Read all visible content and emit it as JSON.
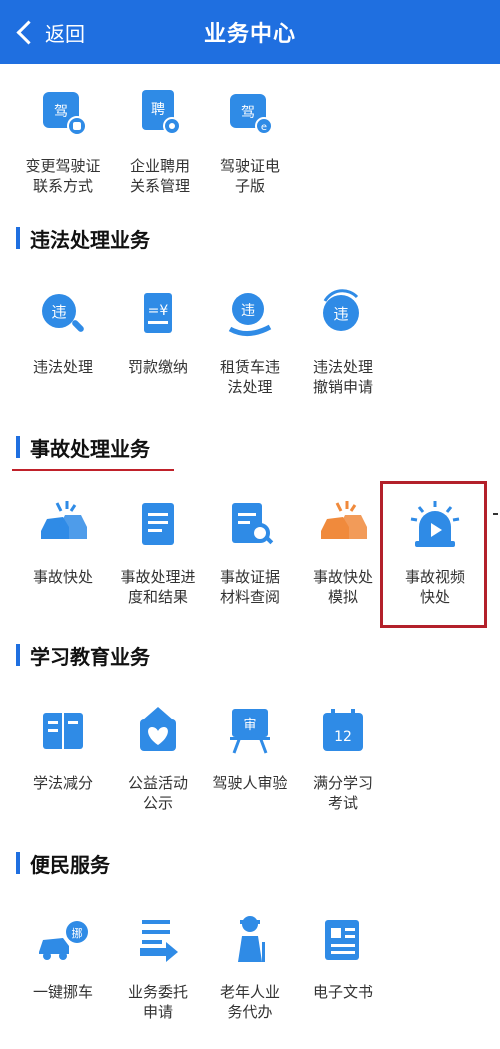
{
  "header": {
    "back_label": "返回",
    "title": "业务中心"
  },
  "top_row": [
    {
      "label": "变更驾驶证\n联系方式",
      "icon": "license-phone-icon"
    },
    {
      "label": "企业聘用\n关系管理",
      "icon": "hire-document-icon"
    },
    {
      "label": "驾驶证电\n子版",
      "icon": "e-license-icon"
    }
  ],
  "sections": [
    {
      "title": "违法处理业务",
      "items": [
        {
          "label": "违法处理",
          "icon": "violation-search-icon"
        },
        {
          "label": "罚款缴纳",
          "icon": "fine-payment-icon"
        },
        {
          "label": "租赁车违\n法处理",
          "icon": "rental-violation-icon"
        },
        {
          "label": "违法处理\n撤销申请",
          "icon": "violation-revoke-icon"
        }
      ]
    },
    {
      "title": "事故处理业务",
      "items": [
        {
          "label": "事故快处",
          "icon": "accident-quick-icon"
        },
        {
          "label": "事故处理进\n度和结果",
          "icon": "accident-progress-icon"
        },
        {
          "label": "事故证据\n材料查阅",
          "icon": "evidence-search-icon"
        },
        {
          "label": "事故快处\n模拟",
          "icon": "accident-simulation-icon"
        },
        {
          "label": "事故视频\n快处",
          "icon": "siren-video-icon"
        }
      ]
    },
    {
      "title": "学习教育业务",
      "items": [
        {
          "label": "学法减分",
          "icon": "book-icon"
        },
        {
          "label": "公益活动\n公示",
          "icon": "charity-heart-icon"
        },
        {
          "label": "驾驶人审验",
          "icon": "review-board-icon"
        },
        {
          "label": "满分学习\n考试",
          "icon": "calendar-12-icon"
        }
      ]
    },
    {
      "title": "便民服务",
      "items": [
        {
          "label": "一键挪车",
          "icon": "move-car-icon"
        },
        {
          "label": "业务委托\n申请",
          "icon": "delegate-list-icon"
        },
        {
          "label": "老年人业\n务代办",
          "icon": "elderly-person-icon"
        },
        {
          "label": "电子文书",
          "icon": "e-document-icon"
        }
      ]
    }
  ],
  "colors": {
    "brand_blue": "#1f6fe0",
    "icon_blue": "#2f8be6",
    "icon_orange": "#f08a3c",
    "highlight_red": "#b3202a"
  },
  "watermark": "驾"
}
